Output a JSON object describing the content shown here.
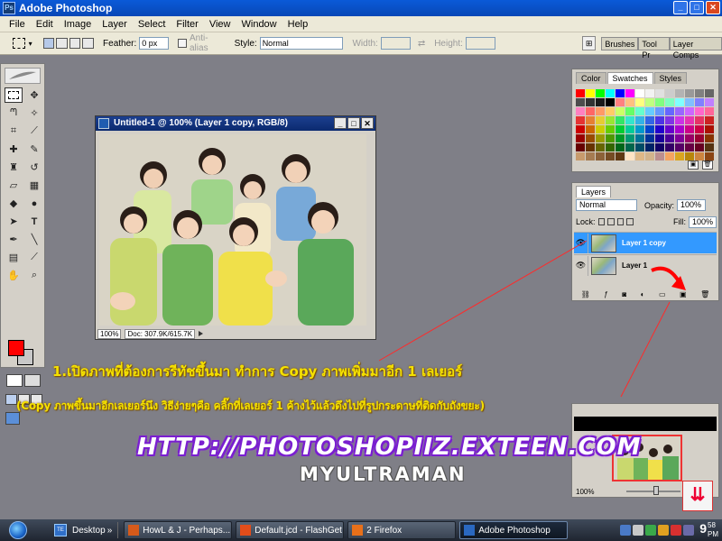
{
  "app": {
    "title": "Adobe Photoshop"
  },
  "menu": [
    "File",
    "Edit",
    "Image",
    "Layer",
    "Select",
    "Filter",
    "View",
    "Window",
    "Help"
  ],
  "options": {
    "feather_label": "Feather:",
    "feather_value": "0 px",
    "antialias_label": "Anti-alias",
    "style_label": "Style:",
    "style_value": "Normal",
    "width_label": "Width:",
    "height_label": "Height:",
    "palette_tabs": [
      "Brushes",
      "Tool Pr",
      "Layer Comps"
    ]
  },
  "document": {
    "title": "Untitled-1 @ 100% (Layer 1 copy, RGB/8)",
    "zoom": "100%",
    "doc_size": "Doc: 307.9K/615.7K"
  },
  "swatches_panel": {
    "tabs": [
      "Color",
      "Swatches",
      "Styles"
    ],
    "active_tab": "Swatches",
    "colors": [
      "#ff0000",
      "#ffff00",
      "#00ff00",
      "#00ffff",
      "#0000ff",
      "#ff00ff",
      "#ffffff",
      "#f2f2f2",
      "#e0e0e0",
      "#cccccc",
      "#b3b3b3",
      "#999999",
      "#808080",
      "#666666",
      "#4d4d4d",
      "#333333",
      "#1a1a1a",
      "#000000",
      "#ff8080",
      "#ffc080",
      "#ffff80",
      "#c0ff80",
      "#80ff80",
      "#80ffc0",
      "#80ffff",
      "#80c0ff",
      "#8080ff",
      "#c080ff",
      "#ff80c0",
      "#ff6666",
      "#ff9966",
      "#ffcc66",
      "#ccff66",
      "#66ff66",
      "#66ffcc",
      "#66ccff",
      "#6699ff",
      "#6666ff",
      "#9966ff",
      "#cc66ff",
      "#ff66cc",
      "#ff6699",
      "#e63333",
      "#e68033",
      "#e6cc33",
      "#99e633",
      "#33e666",
      "#33e6cc",
      "#33b3e6",
      "#3366e6",
      "#4d33e6",
      "#8033e6",
      "#cc33e6",
      "#e633b3",
      "#e63366",
      "#cc2222",
      "#cc0000",
      "#cc6600",
      "#cccc00",
      "#66cc00",
      "#00cc33",
      "#00cc99",
      "#0099cc",
      "#0044cc",
      "#2200cc",
      "#6600cc",
      "#aa00cc",
      "#cc0088",
      "#cc0044",
      "#aa1100",
      "#990000",
      "#994c00",
      "#999900",
      "#4c9900",
      "#009926",
      "#009973",
      "#007399",
      "#003399",
      "#1a0099",
      "#4c0099",
      "#800099",
      "#990066",
      "#990033",
      "#883300",
      "#660000",
      "#663300",
      "#666600",
      "#336600",
      "#006619",
      "#00664c",
      "#004c66",
      "#002266",
      "#110066",
      "#330066",
      "#550066",
      "#660044",
      "#660022",
      "#553311",
      "#c89b6d",
      "#a67c52",
      "#8c6239",
      "#754c24",
      "#603913",
      "#ffe4c4",
      "#deb887",
      "#d2b48c",
      "#bc8f8f",
      "#f4a460",
      "#daa520",
      "#b8860b",
      "#cd853f",
      "#8b4513"
    ]
  },
  "layers_panel": {
    "tab": "Layers",
    "blend_mode": "Normal",
    "opacity_label": "Opacity:",
    "opacity_value": "100%",
    "lock_label": "Lock:",
    "fill_label": "Fill:",
    "fill_value": "100%",
    "layers": [
      {
        "name": "Layer 1 copy",
        "active": true
      },
      {
        "name": "Layer 1",
        "active": false
      }
    ]
  },
  "navigator_panel": {
    "zoom": "100%"
  },
  "overlay": {
    "line1": "1.เปิดภาพที่ต้องการรีทัชขึ้นมา ทำการ Copy ภาพเพิ่มมาอีก 1 เลเยอร์",
    "line2": "(Copy ภาพขึ้นมาอีกเลเยอร์นึง วิธีง่ายๆคือ คลิ๊กที่เลเยอร์ 1 ค้างไว้แล้วดึงไปที่รูปกระดาษที่ติดกับถังขยะ)",
    "url": "HTTP://PHOTOSHOPIIZ.EXTEEN.COM",
    "author": "MYULTRAMAN"
  },
  "taskbar": {
    "desktop_label": "Desktop",
    "tasks": [
      {
        "label": "HowL & J - Perhaps...",
        "icon_color": "#d65a1a"
      },
      {
        "label": "Default.jcd - FlashGet",
        "icon_color": "#e34d1a"
      },
      {
        "label": "2 Firefox",
        "icon_color": "#e8701a"
      },
      {
        "label": "Adobe Photoshop",
        "icon_color": "#2a68c0"
      }
    ],
    "clock_hour": "9",
    "clock_min": "58",
    "clock_ampm": "PM"
  }
}
